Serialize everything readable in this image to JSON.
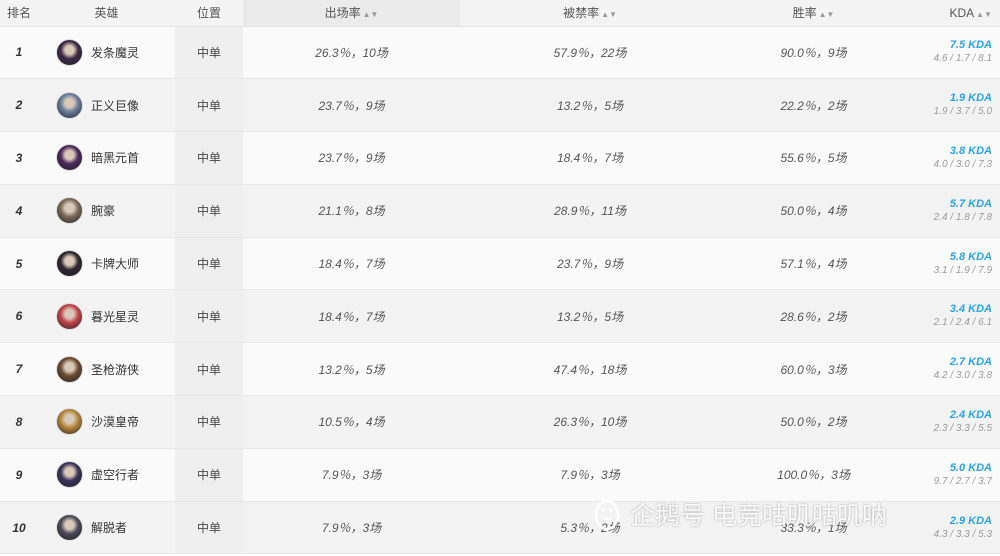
{
  "header": {
    "rank": "排名",
    "hero": "英雄",
    "position": "位置",
    "pick_rate": "出场率",
    "ban_rate": "被禁率",
    "win_rate": "胜率",
    "kda": "KDA",
    "sort_icon": "updown-arrow-icon"
  },
  "rows": [
    {
      "rank": "1",
      "hero": "发条魔灵",
      "avatar_color": "#3b2a44",
      "position": "中单",
      "pick": "26.3％，10场",
      "ban": "57.9％，22场",
      "win": "90.0％，9场",
      "kda": "7.5 KDA",
      "kda_detail": "4.6 / 1.7 / 8.1"
    },
    {
      "rank": "2",
      "hero": "正义巨像",
      "avatar_color": "#6a7d9c",
      "position": "中单",
      "pick": "23.7％，9场",
      "ban": "13.2％，5场",
      "win": "22.2％，2场",
      "kda": "1.9 KDA",
      "kda_detail": "1.9 / 3.7 / 5.0"
    },
    {
      "rank": "3",
      "hero": "暗黑元首",
      "avatar_color": "#4a2a5e",
      "position": "中单",
      "pick": "23.7％，9场",
      "ban": "18.4％，7场",
      "win": "55.6％，5场",
      "kda": "3.8 KDA",
      "kda_detail": "4.0 / 3.0 / 7.3"
    },
    {
      "rank": "4",
      "hero": "腕豪",
      "avatar_color": "#7a6a58",
      "position": "中单",
      "pick": "21.1％，8场",
      "ban": "28.9％，11场",
      "win": "50.0％，4场",
      "kda": "5.7 KDA",
      "kda_detail": "2.4 / 1.8 / 7.8"
    },
    {
      "rank": "5",
      "hero": "卡牌大师",
      "avatar_color": "#2f2630",
      "position": "中单",
      "pick": "18.4％，7场",
      "ban": "23.7％，9场",
      "win": "57.1％，4场",
      "kda": "5.8 KDA",
      "kda_detail": "3.1 / 1.9 / 7.9"
    },
    {
      "rank": "6",
      "hero": "暮光星灵",
      "avatar_color": "#c0454a",
      "position": "中单",
      "pick": "18.4％，7场",
      "ban": "13.2％，5场",
      "win": "28.6％，2场",
      "kda": "3.4 KDA",
      "kda_detail": "2.1 / 2.4 / 6.1"
    },
    {
      "rank": "7",
      "hero": "圣枪游侠",
      "avatar_color": "#6b4a32",
      "position": "中单",
      "pick": "13.2％，5场",
      "ban": "47.4％，18场",
      "win": "60.0％，3场",
      "kda": "2.7 KDA",
      "kda_detail": "4.2 / 3.0 / 3.8"
    },
    {
      "rank": "8",
      "hero": "沙漠皇帝",
      "avatar_color": "#b8853a",
      "position": "中单",
      "pick": "10.5％，4场",
      "ban": "26.3％，10场",
      "win": "50.0％，2场",
      "kda": "2.4 KDA",
      "kda_detail": "2.3 / 3.3 / 5.5"
    },
    {
      "rank": "9",
      "hero": "虚空行者",
      "avatar_color": "#3a3358",
      "position": "中单",
      "pick": "7.9％，3场",
      "ban": "7.9％，3场",
      "win": "100.0％，3场",
      "kda": "5.0 KDA",
      "kda_detail": "9.7 / 2.7 / 3.7"
    },
    {
      "rank": "10",
      "hero": "解脱者",
      "avatar_color": "#4a4a5a",
      "position": "中单",
      "pick": "7.9％，3场",
      "ban": "5.3％，2场",
      "win": "33.3％，1场",
      "kda": "2.9 KDA",
      "kda_detail": "4.3 / 3.3 / 5.3"
    }
  ],
  "watermark": {
    "text": "企鹅号 电竞咕叽咕叽呐",
    "icon": "penguin-logo-icon"
  }
}
